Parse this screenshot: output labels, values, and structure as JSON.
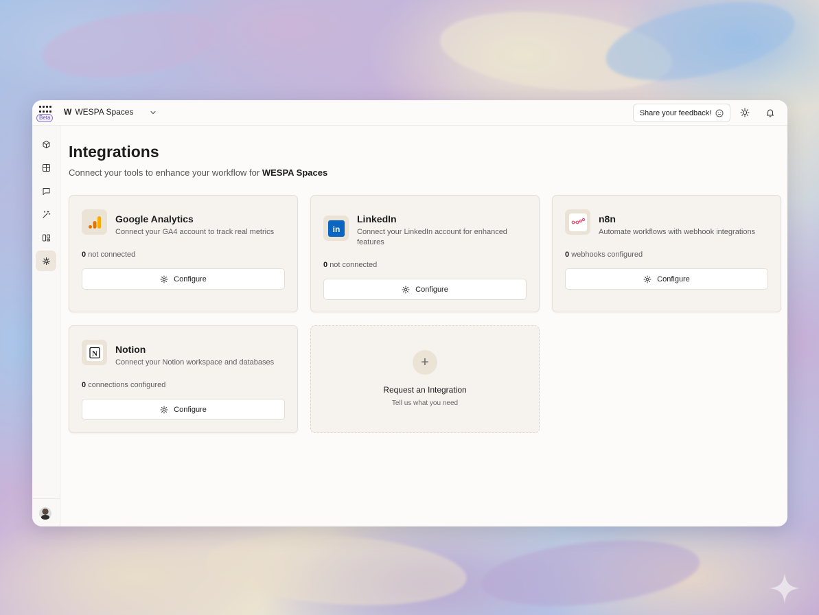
{
  "topbar": {
    "beta_label": "Beta",
    "workspace_mark": "W",
    "workspace_name": "WESPA Spaces",
    "feedback_label": "Share your feedback!"
  },
  "sidebar": {
    "items": [
      {
        "icon": "cube-icon",
        "active": false
      },
      {
        "icon": "grid-icon",
        "active": false
      },
      {
        "icon": "chat-icon",
        "active": false
      },
      {
        "icon": "magic-wand-icon",
        "active": false
      },
      {
        "icon": "board-icon",
        "active": false
      },
      {
        "icon": "integrations-icon",
        "active": true
      }
    ]
  },
  "page": {
    "title": "Integrations",
    "subtitle_prefix": "Connect your tools to enhance your workflow for",
    "subtitle_workspace": "WESPA Spaces"
  },
  "integrations": [
    {
      "name": "Google Analytics",
      "description": "Connect your GA4 account to track real metrics",
      "stat_count": "0",
      "stat_label": "not connected",
      "button": "Configure"
    },
    {
      "name": "LinkedIn",
      "description": "Connect your LinkedIn account for enhanced features",
      "stat_count": "0",
      "stat_label": "not connected",
      "button": "Configure"
    },
    {
      "name": "n8n",
      "description": "Automate workflows with webhook integrations",
      "stat_count": "0",
      "stat_label": "webhooks configured",
      "button": "Configure"
    },
    {
      "name": "Notion",
      "description": "Connect your Notion workspace and databases",
      "stat_count": "0",
      "stat_label": "connections configured",
      "button": "Configure"
    }
  ],
  "request": {
    "title": "Request an Integration",
    "subtitle": "Tell us what you need"
  },
  "colors": {
    "accent_active": "#ede6dd",
    "card_bg": "#f6f2ed",
    "linkedin_blue": "#0a66c2",
    "ga_orange": "#f9ab00"
  }
}
